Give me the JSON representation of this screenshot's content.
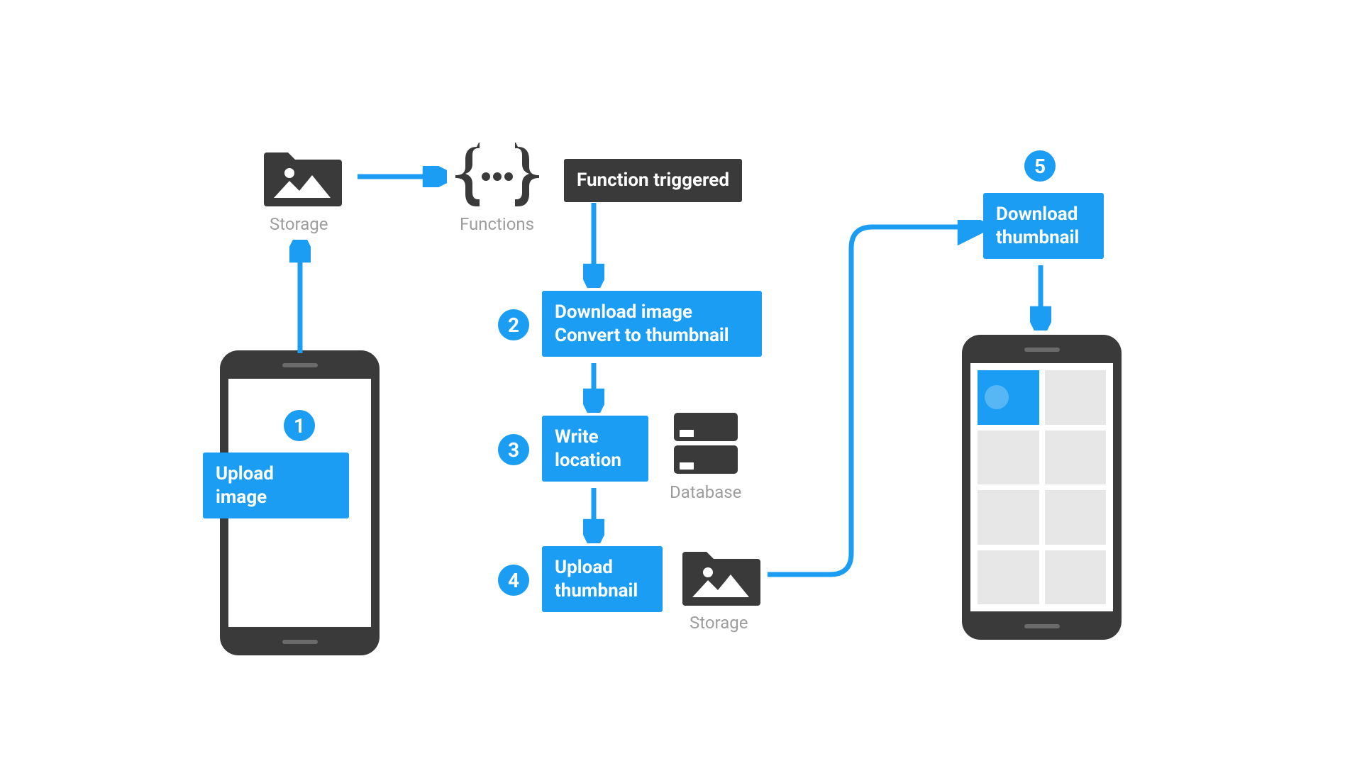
{
  "colors": {
    "blue": "#1b9df4",
    "dark": "#3a3a3a",
    "gray": "#9d9d9d"
  },
  "icons": {
    "storage": "Storage",
    "functions": "Functions",
    "database": "Database",
    "storage2": "Storage"
  },
  "steps": {
    "s1": {
      "num": "1",
      "text": "Upload\nimage"
    },
    "trigger": "Function triggered",
    "s2": {
      "num": "2",
      "text": "Download image\nConvert to thumbnail"
    },
    "s3": {
      "num": "3",
      "text": "Write\nlocation"
    },
    "s4": {
      "num": "4",
      "text": "Upload\nthumbnail"
    },
    "s5": {
      "num": "5",
      "text": "Download\nthumbnail"
    }
  }
}
